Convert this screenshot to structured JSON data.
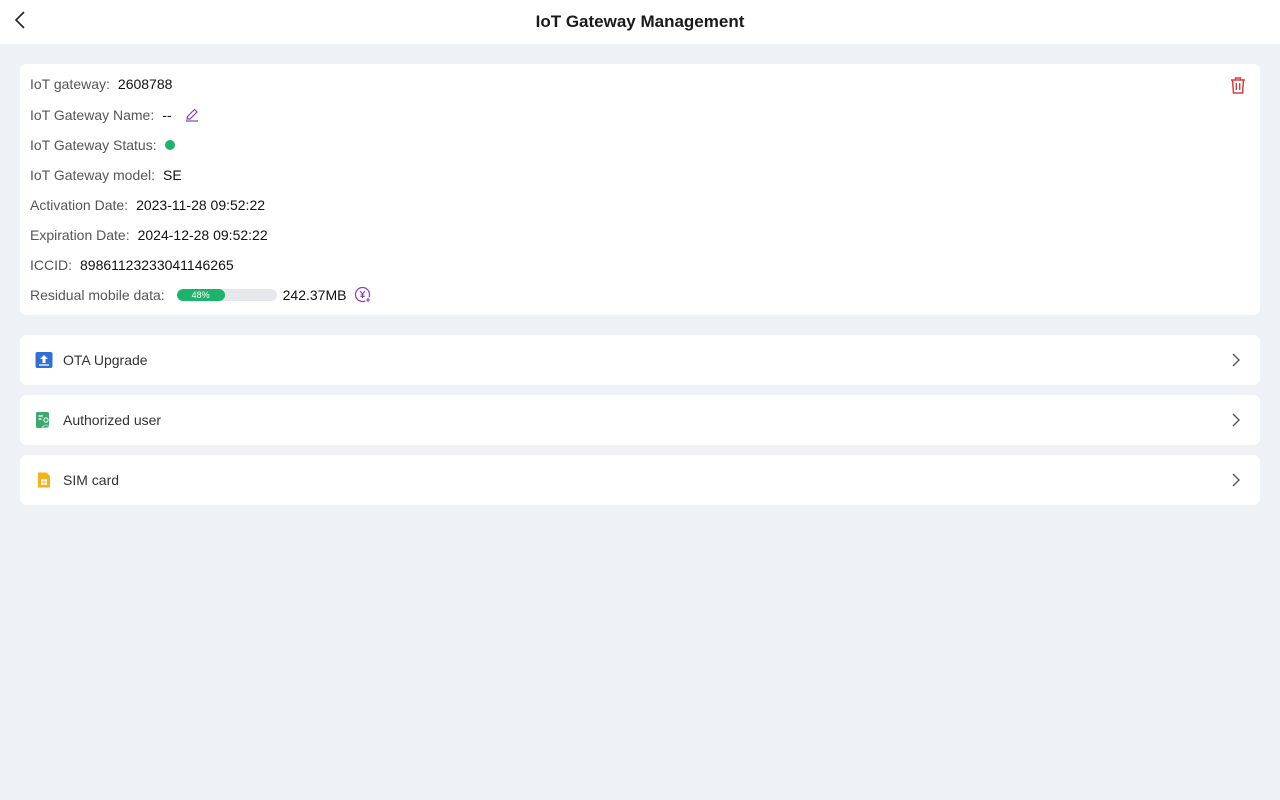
{
  "header": {
    "title": "IoT Gateway Management"
  },
  "gateway": {
    "id_label": "IoT gateway:",
    "id_value": "2608788",
    "name_label": "IoT Gateway Name:",
    "name_value": "--",
    "status_label": "IoT Gateway Status:",
    "status_color": "#1db36a",
    "model_label": "IoT Gateway model:",
    "model_value": "SE",
    "activation_label": "Activation Date:",
    "activation_value": "2023-11-28 09:52:22",
    "expiration_label": "Expiration Date:",
    "expiration_value": "2024-12-28 09:52:22",
    "iccid_label": "ICCID:",
    "iccid_value": "89861123233041146265",
    "data_label": "Residual mobile data:",
    "data_percent": 48,
    "data_percent_text": "48%",
    "data_amount": "242.37MB"
  },
  "menu": [
    {
      "label": "OTA Upgrade",
      "icon": "upload-icon",
      "color": "#2f6fd6"
    },
    {
      "label": "Authorized user",
      "icon": "authorized-user-icon",
      "color": "#3daa6b"
    },
    {
      "label": "SIM card",
      "icon": "sim-card-icon",
      "color": "#f5b21b"
    }
  ],
  "colors": {
    "accent_purple": "#8a3fb8",
    "danger": "#e23b3b",
    "success": "#1db36a"
  }
}
